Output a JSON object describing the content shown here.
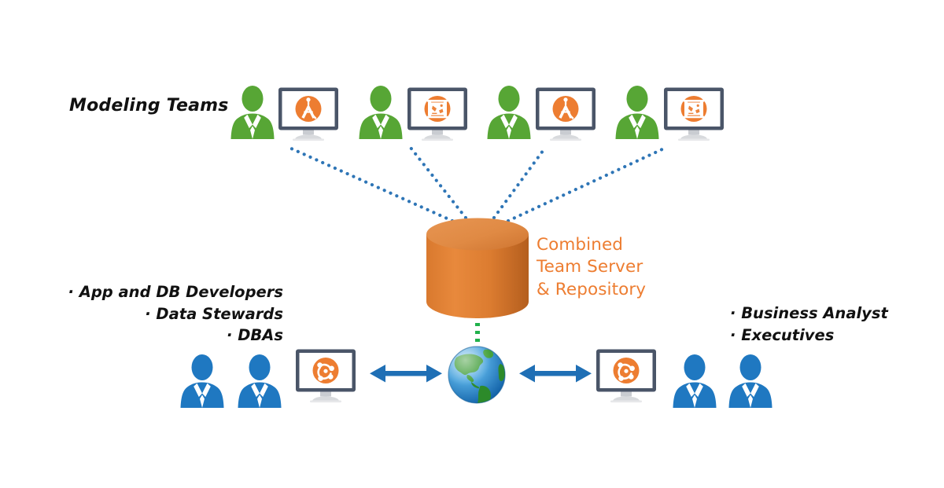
{
  "diagram": {
    "title_label": "Modeling Teams",
    "center": {
      "line1": "Combined",
      "line2": "Team Server",
      "line3": "& Repository",
      "color": "#ED7D31",
      "shape": "cylinder-database"
    },
    "left_roles": {
      "line1": "· App and DB Developers",
      "line2": "· Data Stewards",
      "line3": "· DBAs"
    },
    "right_roles": {
      "line1": "· Business Analyst",
      "line2": "· Executives"
    },
    "top_row": {
      "count": 4,
      "person_color": "#57A635",
      "monitor_icons": [
        "compass-divider-icon",
        "blueprint-scroll-icon",
        "compass-divider-icon",
        "blueprint-scroll-icon"
      ]
    },
    "bottom_row": {
      "person_color": "#1F78C1",
      "monitor_icon": "network-hub-icon",
      "globe_icon": "globe-americas-icon",
      "arrow_icon": "double-headed-arrow-icon",
      "arrow_color": "#1F6FB5"
    },
    "connectors": {
      "top_style": "blue-dotted",
      "top_color": "#2E75B6",
      "bottom_style": "green-dotted",
      "bottom_color": "#21B14B"
    },
    "colors": {
      "green": "#57A635",
      "blue": "#1F78C1",
      "orange": "#ED7D31",
      "cylinder": "#DD7F32",
      "bezel": "#4A5568",
      "background": "#FFFFFF"
    }
  }
}
